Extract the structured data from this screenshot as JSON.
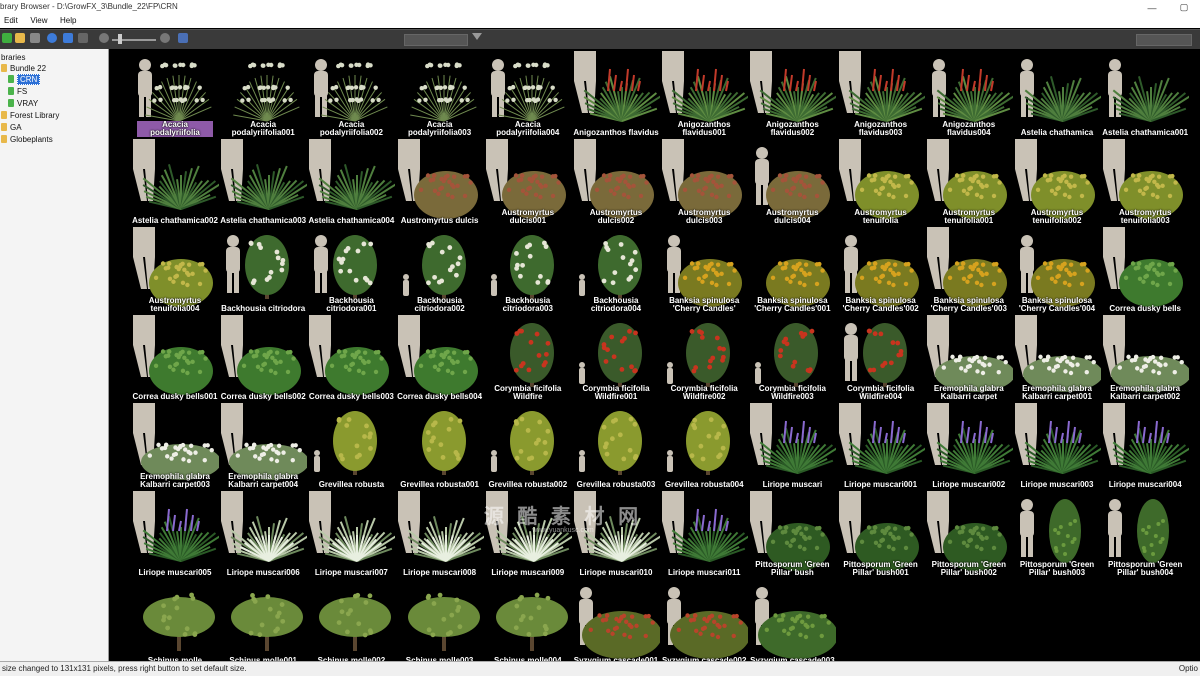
{
  "window": {
    "title": "brary Browser - D:\\GrowFX_3\\Bundle_22\\FP\\CRN",
    "buttons": [
      "—",
      "▢"
    ]
  },
  "menu": [
    "Edit",
    "View",
    "Help"
  ],
  "toolbar": {
    "icons": [
      "play-icon",
      "folder-open-icon",
      "save-icon",
      "refresh-icon",
      "globe-icon",
      "sort-icon",
      "zoom-out-icon",
      "zoom-in-icon",
      "help-icon",
      "filter-icon"
    ],
    "colors": {
      "background": "#3a3a3a",
      "icon_green": "#3fae3f",
      "icon_yellow": "#e8b84a",
      "icon_blue": "#3d7bd9"
    }
  },
  "sidebar": {
    "header": "braries",
    "tree": [
      {
        "label": "Bundle 22",
        "icon": "folder",
        "depth": 0
      },
      {
        "label": "CRN",
        "icon": "folder-green",
        "depth": 1,
        "selected": true
      },
      {
        "label": "FS",
        "icon": "folder-green",
        "depth": 1
      },
      {
        "label": "VRAY",
        "icon": "folder-green",
        "depth": 1
      },
      {
        "label": "Forest Library",
        "icon": "folder",
        "depth": 0
      },
      {
        "label": "GA",
        "icon": "folder",
        "depth": 0
      },
      {
        "label": "Globeplants",
        "icon": "folder",
        "depth": 0
      }
    ]
  },
  "grid": {
    "items": [
      {
        "label": "Acacia podalyriifolia",
        "type": "shrub-white",
        "fig": "person",
        "selected": true
      },
      {
        "label": "Acacia\npodalyriifolia001",
        "type": "shrub-white",
        "fig": "none"
      },
      {
        "label": "Acacia\npodalyriifolia002",
        "type": "shrub-white",
        "fig": "person"
      },
      {
        "label": "Acacia\npodalyriifolia003",
        "type": "shrub-white",
        "fig": "none"
      },
      {
        "label": "Acacia\npodalyriifolia004",
        "type": "shrub-white",
        "fig": "person"
      },
      {
        "label": "Anigozanthos flavidus",
        "type": "kangaroo",
        "fig": "legs"
      },
      {
        "label": "Anigozanthos\nflavidus001",
        "type": "kangaroo",
        "fig": "legs"
      },
      {
        "label": "Anigozanthos\nflavidus002",
        "type": "kangaroo",
        "fig": "legs"
      },
      {
        "label": "Anigozanthos\nflavidus003",
        "type": "kangaroo",
        "fig": "legs"
      },
      {
        "label": "Anigozanthos\nflavidus004",
        "type": "kangaroo",
        "fig": "person"
      },
      {
        "label": "Astelia chathamica",
        "type": "grass",
        "fig": "person"
      },
      {
        "label": "Astelia chathamica001",
        "type": "grass",
        "fig": "person"
      },
      {
        "label": "Astelia chathamica002",
        "type": "grass",
        "fig": "legs"
      },
      {
        "label": "Astelia chathamica003",
        "type": "grass",
        "fig": "legs"
      },
      {
        "label": "Astelia chathamica004",
        "type": "grass",
        "fig": "legs"
      },
      {
        "label": "Austromyrtus dulcis",
        "type": "bush-red",
        "fig": "legs"
      },
      {
        "label": "Austromyrtus\ndulcis001",
        "type": "bush-red",
        "fig": "legs"
      },
      {
        "label": "Austromyrtus\ndulcis002",
        "type": "bush-red",
        "fig": "legs"
      },
      {
        "label": "Austromyrtus\ndulcis003",
        "type": "bush-red",
        "fig": "legs"
      },
      {
        "label": "Austromyrtus\ndulcis004",
        "type": "bush-red",
        "fig": "person"
      },
      {
        "label": "Austromyrtus\ntenuifolia",
        "type": "bush-yellow",
        "fig": "legs"
      },
      {
        "label": "Austromyrtus\ntenuifolia001",
        "type": "bush-yellow",
        "fig": "legs"
      },
      {
        "label": "Austromyrtus\ntenuifolia002",
        "type": "bush-yellow",
        "fig": "legs"
      },
      {
        "label": "Austromyrtus\ntenuifolia003",
        "type": "bush-yellow",
        "fig": "legs"
      },
      {
        "label": "Austromyrtus\ntenuifolia004",
        "type": "bush-yellow",
        "fig": "legs"
      },
      {
        "label": "Backhousia citriodora",
        "type": "tree-white",
        "fig": "person"
      },
      {
        "label": "Backhousia\ncitriodora001",
        "type": "tree-white",
        "fig": "person"
      },
      {
        "label": "Backhousia\ncitriodora002",
        "type": "tree-white",
        "fig": "small"
      },
      {
        "label": "Backhousia\ncitriodora003",
        "type": "tree-white",
        "fig": "small"
      },
      {
        "label": "Backhousia\ncitriodora004",
        "type": "tree-white",
        "fig": "small"
      },
      {
        "label": "Banksia spinulosa\n'Cherry Candles'",
        "type": "banksia",
        "fig": "person"
      },
      {
        "label": "Banksia spinulosa\n'Cherry Candles'001",
        "type": "banksia",
        "fig": "none"
      },
      {
        "label": "Banksia spinulosa\n'Cherry Candles'002",
        "type": "banksia",
        "fig": "person"
      },
      {
        "label": "Banksia spinulosa\n'Cherry Candles'003",
        "type": "banksia",
        "fig": "legs"
      },
      {
        "label": "Banksia spinulosa\n'Cherry Candles'004",
        "type": "banksia",
        "fig": "person"
      },
      {
        "label": "Correa dusky bells",
        "type": "bush-green",
        "fig": "legs"
      },
      {
        "label": "Correa dusky bells001",
        "type": "bush-green",
        "fig": "legs"
      },
      {
        "label": "Correa dusky bells002",
        "type": "bush-green",
        "fig": "legs"
      },
      {
        "label": "Correa dusky bells003",
        "type": "bush-green",
        "fig": "legs"
      },
      {
        "label": "Correa dusky bells004",
        "type": "bush-green",
        "fig": "legs"
      },
      {
        "label": "Corymbia ficifolia\nWildfire",
        "type": "tree-red",
        "fig": "none"
      },
      {
        "label": "Corymbia ficifolia\nWildfire001",
        "type": "tree-red",
        "fig": "small"
      },
      {
        "label": "Corymbia ficifolia\nWildfire002",
        "type": "tree-red",
        "fig": "small"
      },
      {
        "label": "Corymbia ficifolia\nWildfire003",
        "type": "tree-red",
        "fig": "small"
      },
      {
        "label": "Corymbia ficifolia\nWildfire004",
        "type": "tree-red",
        "fig": "person"
      },
      {
        "label": "Eremophila glabra\nKalbarri carpet",
        "type": "ground-white",
        "fig": "legs"
      },
      {
        "label": "Eremophila glabra\nKalbarri carpet001",
        "type": "ground-white",
        "fig": "legs"
      },
      {
        "label": "Eremophila glabra\nKalbarri carpet002",
        "type": "ground-white",
        "fig": "legs"
      },
      {
        "label": "Eremophila glabra\nKalbarri carpet003",
        "type": "ground-white",
        "fig": "legs"
      },
      {
        "label": "Eremophila glabra\nKalbarri carpet004",
        "type": "ground-white",
        "fig": "legs"
      },
      {
        "label": "Grevillea robusta",
        "type": "tree-olive",
        "fig": "small"
      },
      {
        "label": "Grevillea robusta001",
        "type": "tree-olive",
        "fig": "none"
      },
      {
        "label": "Grevillea robusta002",
        "type": "tree-olive",
        "fig": "small"
      },
      {
        "label": "Grevillea robusta003",
        "type": "tree-olive",
        "fig": "small"
      },
      {
        "label": "Grevillea robusta004",
        "type": "tree-olive",
        "fig": "small"
      },
      {
        "label": "Liriope muscari",
        "type": "liriope",
        "fig": "legs"
      },
      {
        "label": "Liriope muscari001",
        "type": "liriope",
        "fig": "legs"
      },
      {
        "label": "Liriope muscari002",
        "type": "liriope",
        "fig": "legs"
      },
      {
        "label": "Liriope muscari003",
        "type": "liriope",
        "fig": "legs"
      },
      {
        "label": "Liriope muscari004",
        "type": "liriope",
        "fig": "legs"
      },
      {
        "label": "Liriope muscari005",
        "type": "liriope",
        "fig": "legs"
      },
      {
        "label": "Liriope muscari006",
        "type": "grass-white",
        "fig": "legs"
      },
      {
        "label": "Liriope muscari007",
        "type": "grass-white",
        "fig": "legs"
      },
      {
        "label": "Liriope muscari008",
        "type": "grass-white",
        "fig": "legs"
      },
      {
        "label": "Liriope muscari009",
        "type": "grass-white",
        "fig": "legs"
      },
      {
        "label": "Liriope muscari010",
        "type": "grass-white",
        "fig": "legs"
      },
      {
        "label": "Liriope muscari011",
        "type": "liriope",
        "fig": "legs"
      },
      {
        "label": "Pittosporum 'Green\nPillar' bush",
        "type": "bush-dark",
        "fig": "legs"
      },
      {
        "label": "Pittosporum 'Green\nPillar' bush001",
        "type": "bush-dark",
        "fig": "legs"
      },
      {
        "label": "Pittosporum 'Green\nPillar' bush002",
        "type": "bush-dark",
        "fig": "legs"
      },
      {
        "label": "Pittosporum 'Green\nPillar' bush003",
        "type": "pillar",
        "fig": "person"
      },
      {
        "label": "Pittosporum 'Green\nPillar' bush004",
        "type": "pillar",
        "fig": "person"
      },
      {
        "label": "Schinus molle",
        "type": "tree-willow",
        "fig": "none"
      },
      {
        "label": "Schinus molle001",
        "type": "tree-willow",
        "fig": "none"
      },
      {
        "label": "Schinus molle002",
        "type": "tree-willow",
        "fig": "none"
      },
      {
        "label": "Schinus molle003",
        "type": "tree-willow",
        "fig": "none"
      },
      {
        "label": "Schinus molle004",
        "type": "tree-willow",
        "fig": "none"
      },
      {
        "label": "Syzygium cascade001",
        "type": "hedge-red",
        "fig": "person"
      },
      {
        "label": "Syzygium cascade002",
        "type": "hedge-red",
        "fig": "person"
      },
      {
        "label": "Syzygium cascade003",
        "type": "hedge-green",
        "fig": "person"
      }
    ]
  },
  "watermark": {
    "line1": "源 酷 素 材 网",
    "line2": "www.yuankusc.com"
  },
  "status": {
    "message": "size changed to 131x131 pixels, press right button to set default size.",
    "right": "Optio"
  }
}
